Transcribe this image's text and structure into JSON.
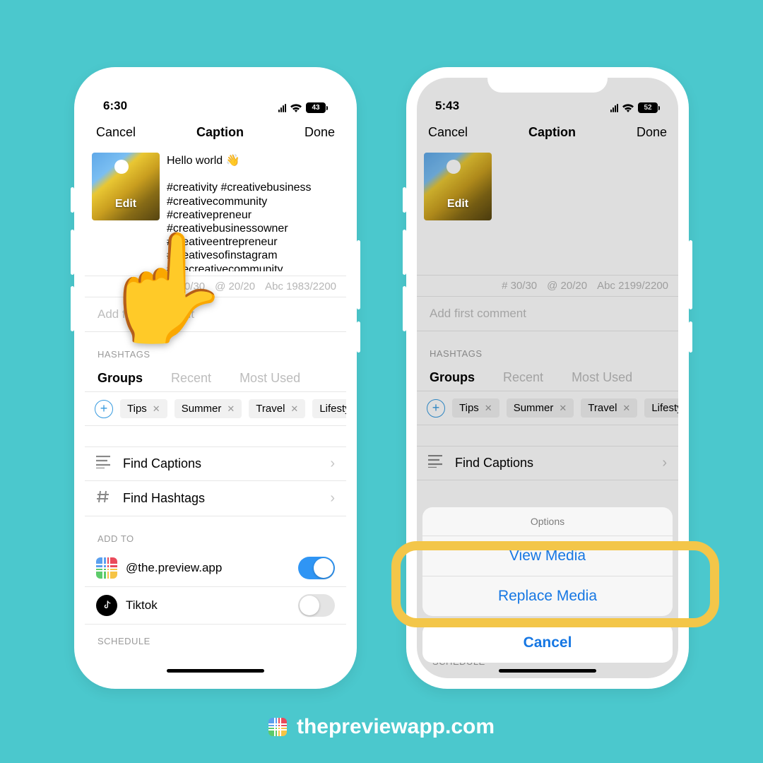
{
  "phone1": {
    "status_time": "6:30",
    "battery": "43",
    "nav": {
      "cancel": "Cancel",
      "title": "Caption",
      "done": "Done"
    },
    "thumb_label": "Edit",
    "caption_text": "Hello world 👋\n\n#creativity #creativebusiness #creativecommunity #creativepreneur #creativebusinessowner #creativeentrepreneur #creativesofinstagram #thecreativecommunity",
    "counters": {
      "hash": "# 30/30",
      "at": "@ 20/20",
      "abc": "Abc 1983/2200"
    },
    "first_comment_placeholder": "Add first comment",
    "section_hashtags": "HASHTAGS",
    "tabs": {
      "groups": "Groups",
      "recent": "Recent",
      "most_used": "Most Used"
    },
    "chips": [
      "Tips",
      "Summer",
      "Travel",
      "Lifestyle"
    ],
    "find_captions": "Find Captions",
    "find_hashtags": "Find Hashtags",
    "section_addto": "ADD TO",
    "addto_preview": "@the.preview.app",
    "addto_tiktok": "Tiktok",
    "section_schedule": "SCHEDULE"
  },
  "phone2": {
    "status_time": "5:43",
    "battery": "52",
    "nav": {
      "cancel": "Cancel",
      "title": "Caption",
      "done": "Done"
    },
    "thumb_label": "Edit",
    "counters": {
      "hash": "# 30/30",
      "at": "@ 20/20",
      "abc": "Abc 2199/2200"
    },
    "first_comment_placeholder": "Add first comment",
    "section_hashtags": "HASHTAGS",
    "tabs": {
      "groups": "Groups",
      "recent": "Recent",
      "most_used": "Most Used"
    },
    "chips": [
      "Tips",
      "Summer",
      "Travel",
      "Lifestyle"
    ],
    "find_captions": "Find Captions",
    "section_schedule": "SCHEDULE",
    "sheet_title": "Options",
    "sheet_item1": "View Media",
    "sheet_item2": "Replace Media",
    "sheet_cancel": "Cancel"
  },
  "footer": "thepreviewapp.com"
}
